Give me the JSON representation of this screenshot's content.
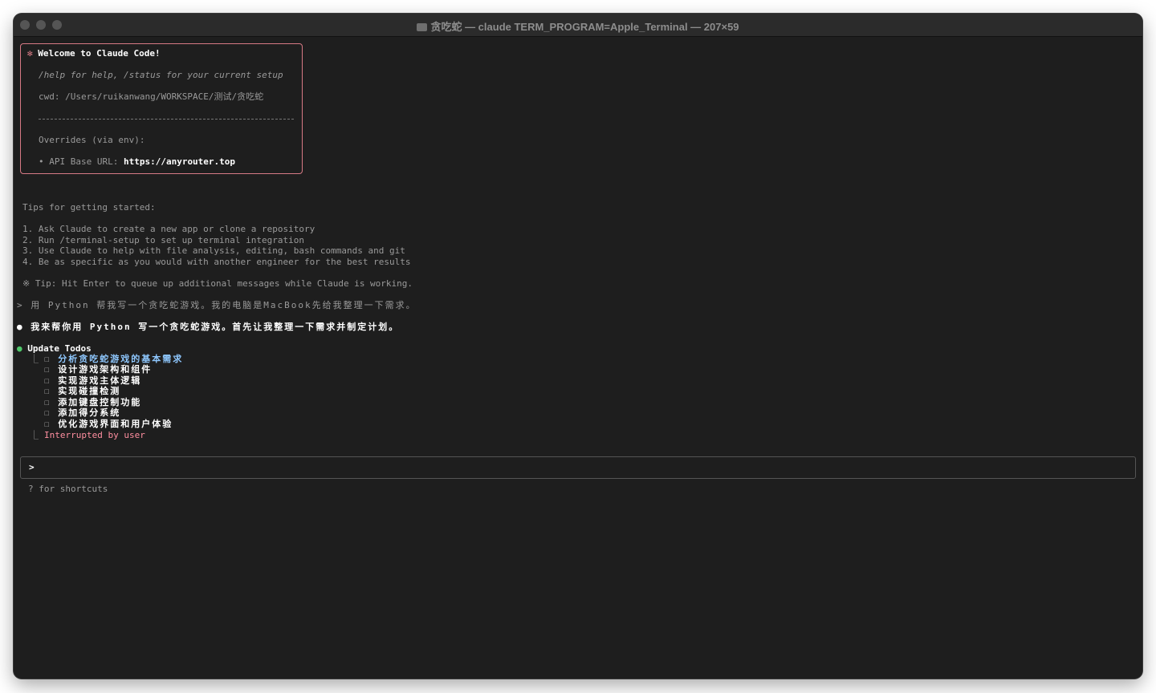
{
  "window": {
    "title": "贪吃蛇 — claude TERM_PROGRAM=Apple_Terminal — 207×59"
  },
  "welcome": {
    "star": "✻",
    "prefix": "Welcome to ",
    "product": "Claude Code",
    "suffix": "!",
    "help": "/help for help, /status for your current setup",
    "cwd": "cwd: /Users/ruikanwang/WORKSPACE/测试/贪吃蛇",
    "overrides_title": "Overrides (via env):",
    "api_label": "• API Base URL: ",
    "api_url": "https://anyrouter.top"
  },
  "tips": {
    "heading": "Tips for getting started:",
    "items": [
      {
        "num": "1.",
        "text": " Ask Claude to create a new app or clone a repository"
      },
      {
        "num": "2.",
        "text": " Run /terminal-setup to set up terminal integration"
      },
      {
        "num": "3.",
        "text": " Use Claude to help with file analysis, editing, bash commands and git"
      },
      {
        "num": "4.",
        "text": " Be as specific as you would with another engineer for the best results"
      }
    ],
    "hint": "※ Tip: Hit Enter to queue up additional messages while Claude is working."
  },
  "conversation": {
    "user_prompt": "> 用 Python 帮我写一个贪吃蛇游戏。我的电脑是MacBook先给我整理一下需求。",
    "assistant_bullet": "●",
    "assistant_reply": "我来帮你用 Python 写一个贪吃蛇游戏。首先让我整理一下需求并制定计划。",
    "todos_bullet": "●",
    "todos_title": "Update Todos",
    "todo_branch": "⎿",
    "todo_checkbox": "☐",
    "todos": [
      "分析贪吃蛇游戏的基本需求",
      "设计游戏架构和组件",
      "实现游戏主体逻辑",
      "实现碰撞检测",
      "添加键盘控制功能",
      "添加得分系统",
      "优化游戏界面和用户体验"
    ],
    "interrupted_branch": "⎿",
    "interrupted": "Interrupted by user"
  },
  "input": {
    "prompt": ">",
    "value": "",
    "footer": "? for shortcuts"
  },
  "colors": {
    "background": "#1e1e1e",
    "accent": "#d77a85",
    "bullet_green": "#4fc76a",
    "todo_active": "#8fc8ff",
    "interrupted": "#ff8fa0"
  }
}
